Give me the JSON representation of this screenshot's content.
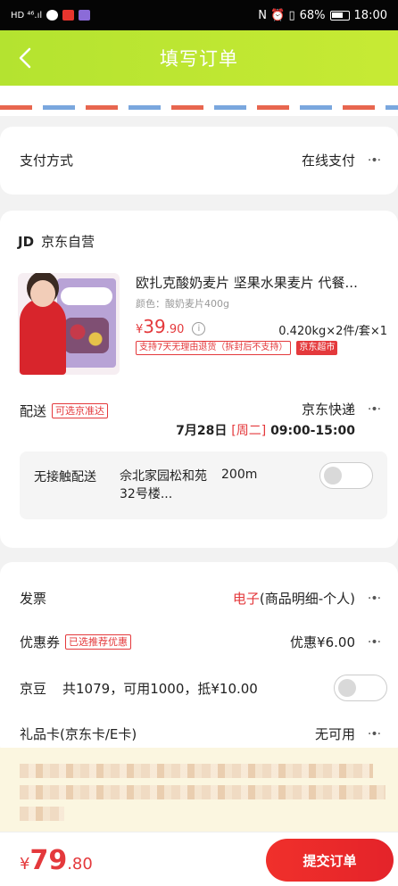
{
  "status_bar": {
    "left_signal": "HD ⁴⁶.ıl",
    "right_percent": "68%",
    "time": "18:00",
    "right_icons": "N ⏰ ▯"
  },
  "header": {
    "title": "填写订单"
  },
  "payment": {
    "label": "支付方式",
    "value": "在线支付"
  },
  "store": {
    "logo": "JD",
    "name": "京东自营"
  },
  "product": {
    "title": "欧扎克酸奶麦片 坚果水果麦片 代餐...",
    "spec": "颜色：酸奶麦片400g",
    "price_symbol": "¥",
    "price_int": "39",
    "price_dec": ".90",
    "quantity": "0.420kg×2件/套×1",
    "tag_return": "支持7天无理由退货（拆封后不支持）",
    "tag_market": "京东超市"
  },
  "delivery": {
    "label": "配送",
    "label_tag": "可选京准达",
    "method": "京东快递",
    "date": "7月28日",
    "weekday": "[周二]",
    "time": "09:00-15:00"
  },
  "contactless": {
    "label": "无接触配送",
    "address": "佘北家园松和苑32号楼...",
    "distance": "200m"
  },
  "invoice": {
    "label": "发票",
    "type_highlight": "电子",
    "detail": "(商品明细-个人)"
  },
  "coupon": {
    "label": "优惠券",
    "tag": "已选推荐优惠",
    "value": "优惠¥6.00"
  },
  "beans": {
    "label": "京豆",
    "text": "共1079，可用1000，抵¥10.00"
  },
  "giftcard": {
    "label": "礼品卡(京东卡/E卡)",
    "value": "无可用"
  },
  "bottom": {
    "total_symbol": "¥",
    "total_int": "79",
    "total_dec": ".80",
    "submit_label": "提交订单"
  },
  "colors": {
    "header_green": "#b4e330",
    "accent_red": "#e4393c",
    "banner_bg": "#fbf6e0"
  }
}
